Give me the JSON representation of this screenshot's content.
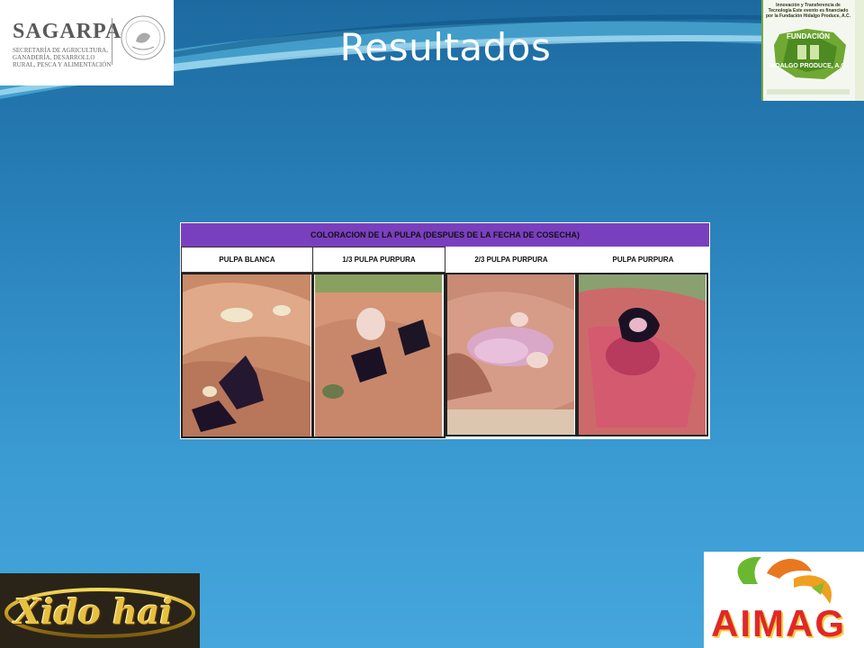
{
  "slide": {
    "title": "Resultados"
  },
  "logos": {
    "sagarpa": {
      "name": "SAGARPA",
      "subtitle": "Secretaría de Agricultura, Ganadería, Desarrollo Rural, Pesca y Alimentación"
    },
    "fundacion": {
      "top_text": "Innovación y Transferencia de Tecnología Este evento es financiado por la Fundación Hidalgo Produce, A.C.",
      "label_1": "FUNDACIÓN",
      "label_2": "HIDALGO PRODUCE, A.C."
    },
    "xido_hai": {
      "name": "Xido hai"
    },
    "aimag": {
      "name": "AIMAG"
    }
  },
  "figure": {
    "header": "COLORACION DE LA PULPA (DESPUES DE LA FECHA DE COSECHA)",
    "columns": [
      {
        "label": "PULPA BLANCA"
      },
      {
        "label": "1/3 PULPA PURPURA"
      },
      {
        "label": "2/3 PULPA PURPURA"
      },
      {
        "label": "PULPA PURPURA"
      }
    ]
  },
  "colors": {
    "header_purple": "#7a3fbf",
    "background_blue": "#2a82bb"
  }
}
